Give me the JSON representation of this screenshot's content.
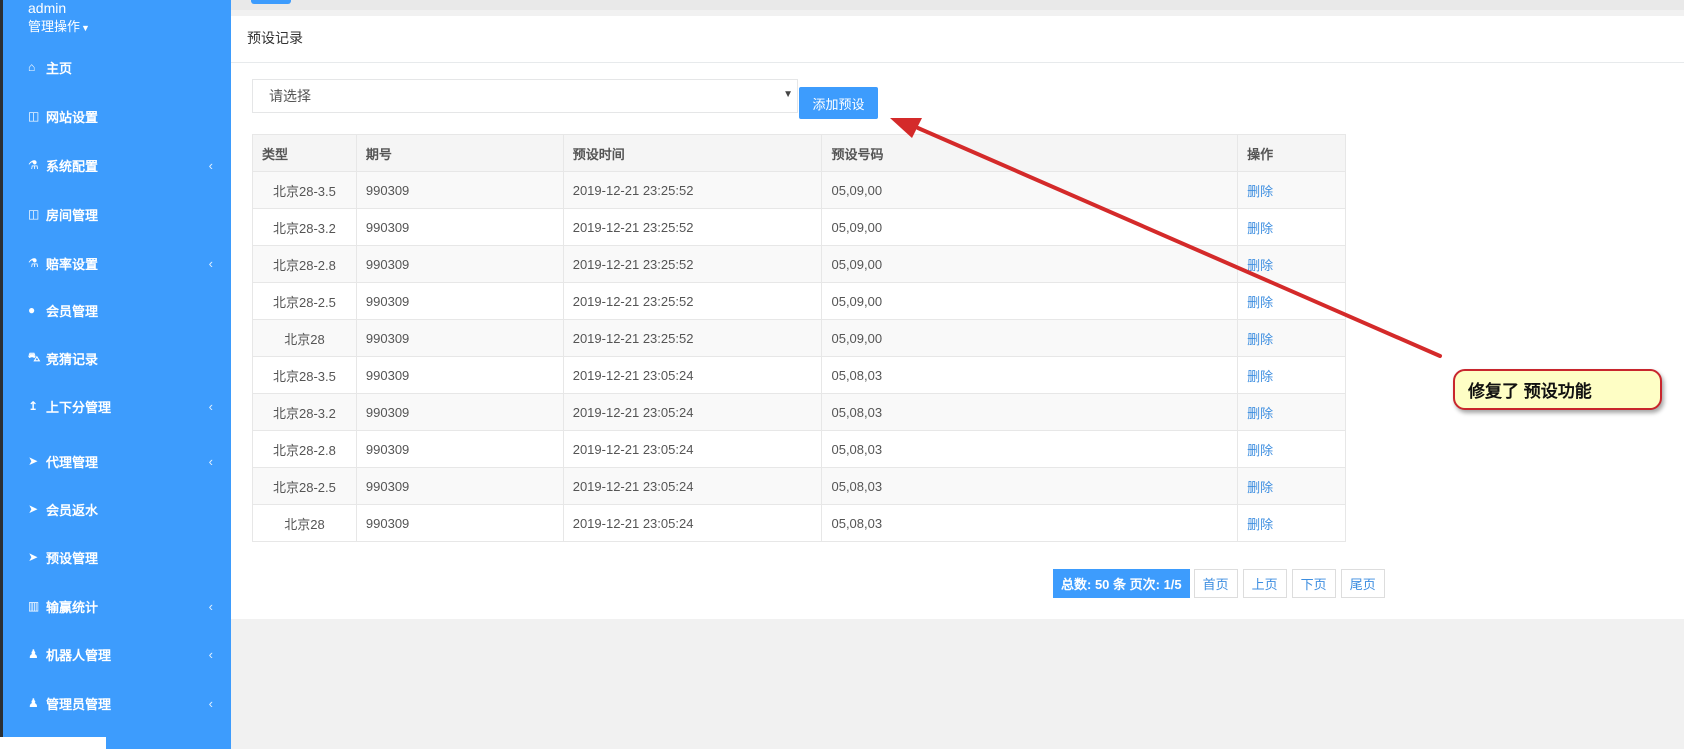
{
  "sidebar": {
    "user_name": "admin",
    "user_menu": "管理操作",
    "items": [
      {
        "label": "主页",
        "icon": "home-icon",
        "glyph": "⌂",
        "chevron": false
      },
      {
        "label": "网站设置",
        "icon": "columns-icon",
        "glyph": "◫",
        "chevron": false
      },
      {
        "label": "系统配置",
        "icon": "flask-icon",
        "glyph": "⚗",
        "chevron": true
      },
      {
        "label": "房间管理",
        "icon": "columns-icon",
        "glyph": "◫",
        "chevron": false
      },
      {
        "label": "赔率设置",
        "icon": "flask-icon",
        "glyph": "⚗",
        "chevron": true
      },
      {
        "label": "会员管理",
        "icon": "user-icon",
        "glyph": "●",
        "chevron": false
      },
      {
        "label": "竞猜记录",
        "icon": "car-icon",
        "glyph": "⛍",
        "chevron": false
      },
      {
        "label": "上下分管理",
        "icon": "arrow-up-icon",
        "glyph": "↥",
        "chevron": true
      },
      {
        "label": "代理管理",
        "icon": "paper-plane-icon",
        "glyph": "➤",
        "chevron": true
      },
      {
        "label": "会员返水",
        "icon": "paper-plane-icon",
        "glyph": "➤",
        "chevron": false
      },
      {
        "label": "预设管理",
        "icon": "paper-plane-icon",
        "glyph": "➤",
        "chevron": false
      },
      {
        "label": "输赢统计",
        "icon": "bar-chart-icon",
        "glyph": "▥",
        "chevron": true
      },
      {
        "label": "机器人管理",
        "icon": "male-icon",
        "glyph": "♟",
        "chevron": true
      },
      {
        "label": "管理员管理",
        "icon": "male-icon",
        "glyph": "♟",
        "chevron": true
      }
    ]
  },
  "panel": {
    "title": "预设记录",
    "select_placeholder": "请选择",
    "add_button": "添加预设"
  },
  "table": {
    "headers": [
      "类型",
      "期号",
      "预设时间",
      "预设号码",
      "操作"
    ],
    "rows": [
      [
        "北京28-3.5",
        "990309",
        "2019-12-21 23:25:52",
        "05,09,00",
        "删除"
      ],
      [
        "北京28-3.2",
        "990309",
        "2019-12-21 23:25:52",
        "05,09,00",
        "删除"
      ],
      [
        "北京28-2.8",
        "990309",
        "2019-12-21 23:25:52",
        "05,09,00",
        "删除"
      ],
      [
        "北京28-2.5",
        "990309",
        "2019-12-21 23:25:52",
        "05,09,00",
        "删除"
      ],
      [
        "北京28",
        "990309",
        "2019-12-21 23:25:52",
        "05,09,00",
        "删除"
      ],
      [
        "北京28-3.5",
        "990309",
        "2019-12-21 23:05:24",
        "05,08,03",
        "删除"
      ],
      [
        "北京28-3.2",
        "990309",
        "2019-12-21 23:05:24",
        "05,08,03",
        "删除"
      ],
      [
        "北京28-2.8",
        "990309",
        "2019-12-21 23:05:24",
        "05,08,03",
        "删除"
      ],
      [
        "北京28-2.5",
        "990309",
        "2019-12-21 23:05:24",
        "05,08,03",
        "删除"
      ],
      [
        "北京28",
        "990309",
        "2019-12-21 23:05:24",
        "05,08,03",
        "删除"
      ]
    ]
  },
  "pagination": {
    "summary": "总数: 50 条 页次: 1/5",
    "first": "首页",
    "prev": "上页",
    "next": "下页",
    "last": "尾页"
  },
  "annotation": {
    "callout_text": "修复了 预设功能",
    "arrow_color": "#d42a2a"
  },
  "colors": {
    "accent": "#3d9cfd",
    "link": "#3d8ee0"
  }
}
